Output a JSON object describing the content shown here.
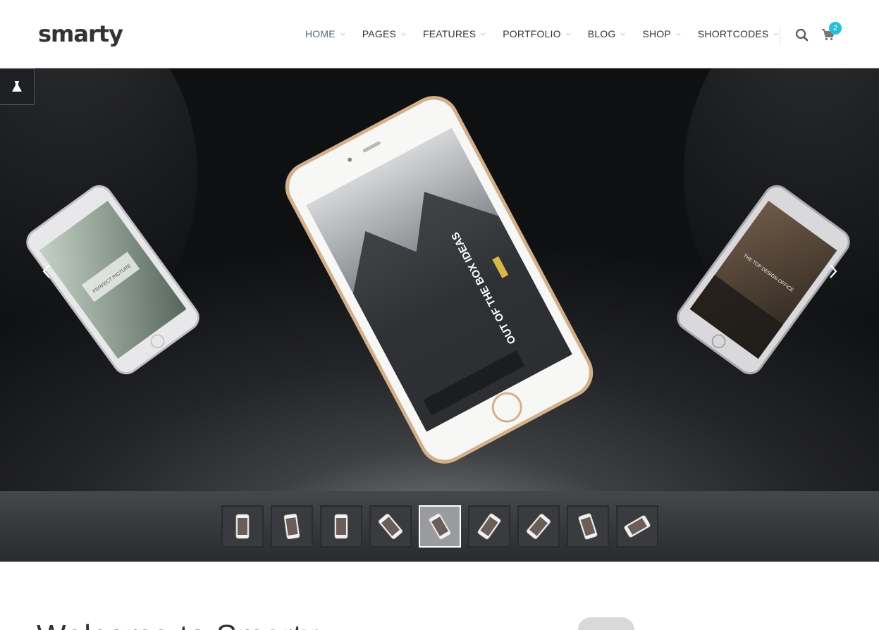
{
  "brand": {
    "logo_text": "smarty",
    "accent_color": "#22c1d9"
  },
  "nav": {
    "items": [
      {
        "label": "HOME",
        "active": true
      },
      {
        "label": "PAGES"
      },
      {
        "label": "FEATURES"
      },
      {
        "label": "PORTFOLIO"
      },
      {
        "label": "BLOG"
      },
      {
        "label": "SHOP"
      },
      {
        "label": "SHORTCODES"
      }
    ],
    "icons": {
      "search": "search-icon",
      "cart": "cart-icon"
    },
    "cart_count": "2"
  },
  "slider": {
    "phone_screen_text": "OUT OF THE BOX IDEAS",
    "left_phone_text": "PERFECT PICTURE",
    "right_phone_text": "THE TOP DESIGN OFFICE",
    "thumbnail_count": 9,
    "active_thumbnail": 5
  },
  "welcome": {
    "heading": "Welcome to Smarty"
  }
}
